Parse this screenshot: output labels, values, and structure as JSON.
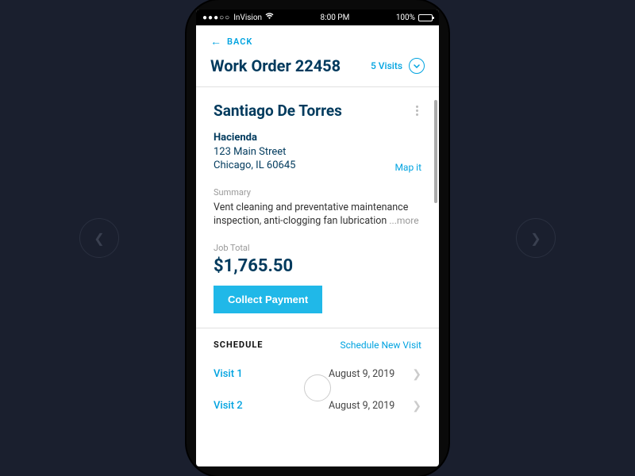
{
  "statusBar": {
    "carrier": "InVision",
    "time": "8:00 PM",
    "battery": "100%"
  },
  "nav": {
    "backLabel": "BACK"
  },
  "header": {
    "title": "Work Order 22458",
    "visitsLabel": "5 Visits"
  },
  "customer": {
    "name": "Santiago De Torres",
    "locationName": "Hacienda",
    "street": "123 Main Street",
    "cityStateZip": "Chicago, IL 60645",
    "mapLabel": "Map it"
  },
  "summary": {
    "label": "Summary",
    "text": "Vent cleaning and preventative maintenance inspection, anti-clogging fan lubrication ",
    "moreLabel": "...more"
  },
  "total": {
    "label": "Job Total",
    "amount": "$1,765.50",
    "collectLabel": "Collect Payment"
  },
  "schedule": {
    "title": "SCHEDULE",
    "newLabel": "Schedule New Visit",
    "visits": [
      {
        "name": "Visit 1",
        "date": "August 9, 2019"
      },
      {
        "name": "Visit 2",
        "date": "August 9, 2019"
      }
    ]
  }
}
